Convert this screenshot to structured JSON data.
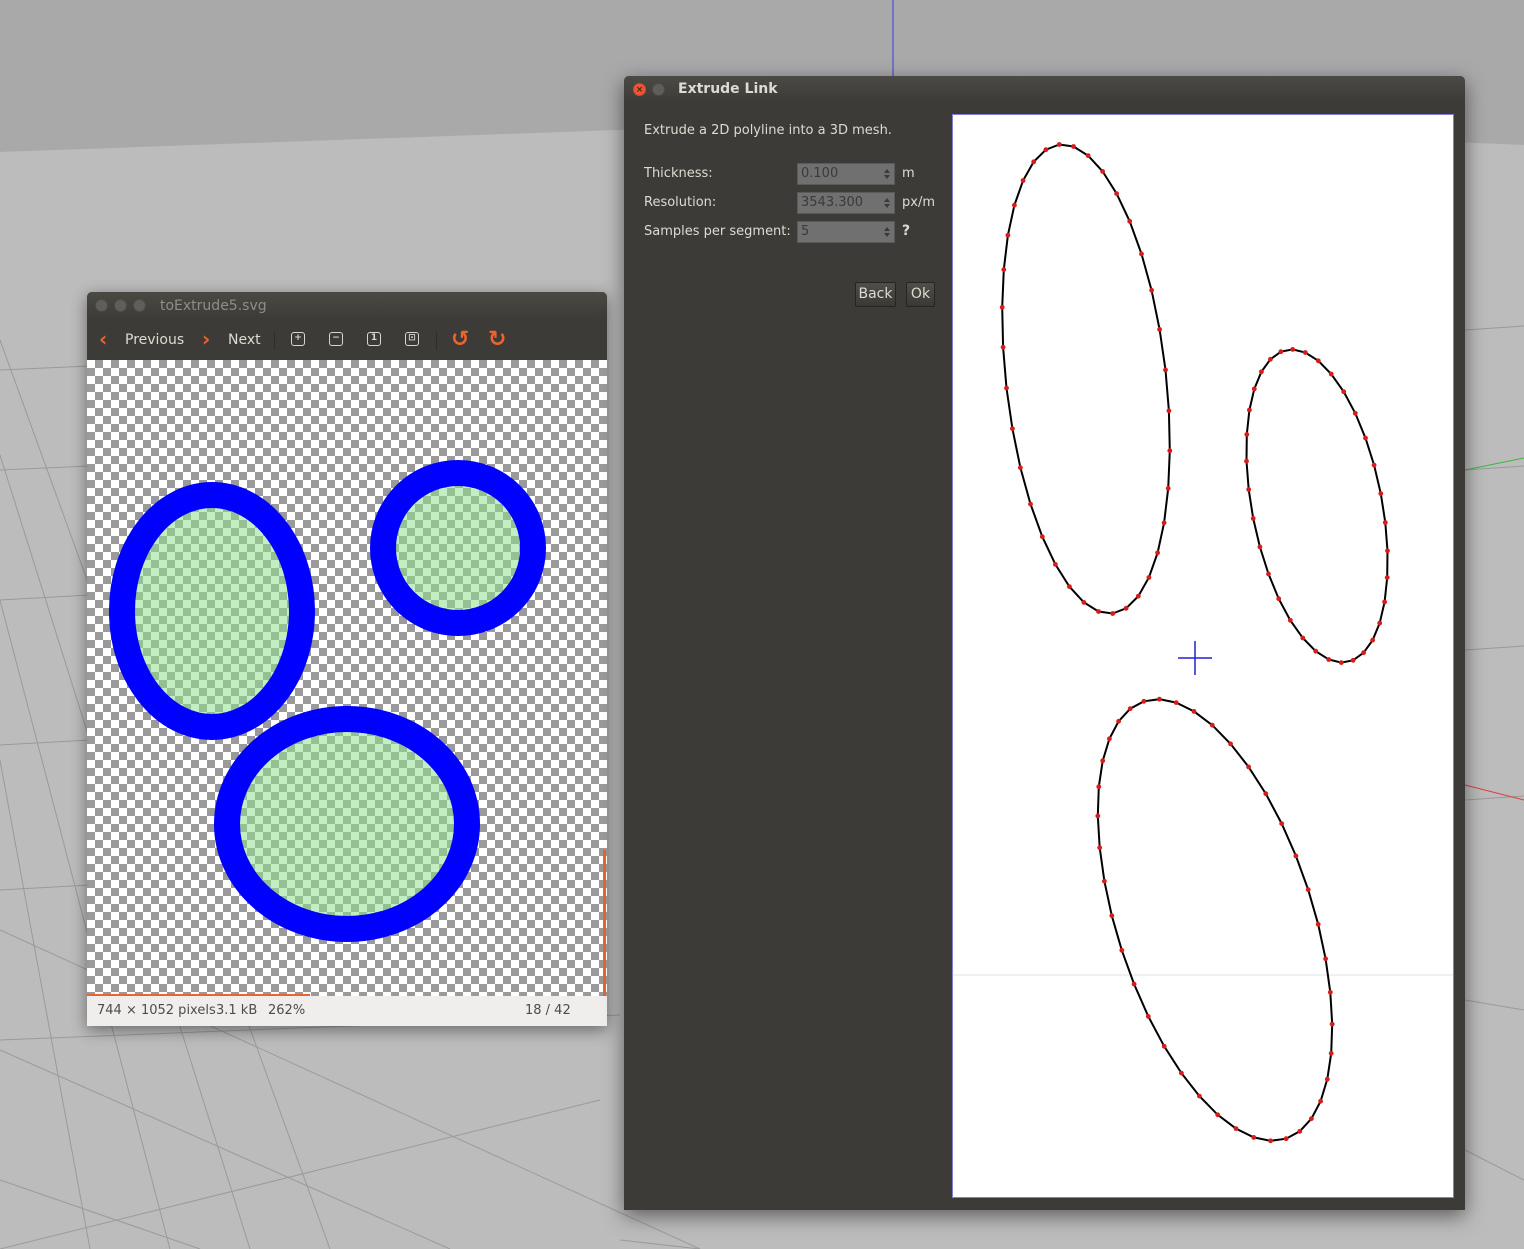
{
  "viewer": {
    "title": "toExtrude5.svg",
    "toolbar": {
      "previous_label": "Previous",
      "next_label": "Next"
    },
    "status": {
      "dimensions": "744 × 1052 pixels",
      "size": "3.1 kB",
      "zoom": "262%",
      "position": "18 / 42"
    },
    "colors": {
      "ring": "#0000ff",
      "fill": "#90ee90",
      "accent": "#e9642e"
    }
  },
  "dialog": {
    "title": "Extrude Link",
    "description": "Extrude a 2D polyline into a 3D mesh.",
    "fields": {
      "thickness": {
        "label": "Thickness:",
        "value": "0.100",
        "unit": "m"
      },
      "resolution": {
        "label": "Resolution:",
        "value": "3543.300",
        "unit": "px/m"
      },
      "samples": {
        "label": "Samples per segment:",
        "value": "5",
        "help": "?"
      }
    },
    "buttons": {
      "back": "Back",
      "ok": "Ok"
    },
    "colors": {
      "polyline": "#000000",
      "point": "#d81b1b",
      "crosshair": "#2020d0"
    }
  }
}
